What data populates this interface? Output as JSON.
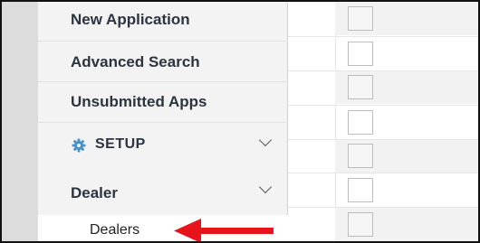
{
  "sidebar": {
    "items": [
      {
        "label": "New Application"
      },
      {
        "label": "Advanced Search"
      },
      {
        "label": "Unsubmitted Apps"
      }
    ],
    "setup": {
      "label": "SETUP",
      "icon": "gear-icon",
      "expanded": true
    },
    "dealer_group": {
      "label": "Dealer",
      "expanded": true
    },
    "dealers_link": {
      "label": "Dealers"
    }
  },
  "annotation": {
    "arrow_color": "#e8141b",
    "points_to": "Dealers"
  },
  "colors": {
    "accent": "#4a90c8",
    "sidebar_bg": "#f3f3f3",
    "text": "#2c3440"
  },
  "grid": {
    "rows": 7,
    "row_checkboxes": true
  }
}
